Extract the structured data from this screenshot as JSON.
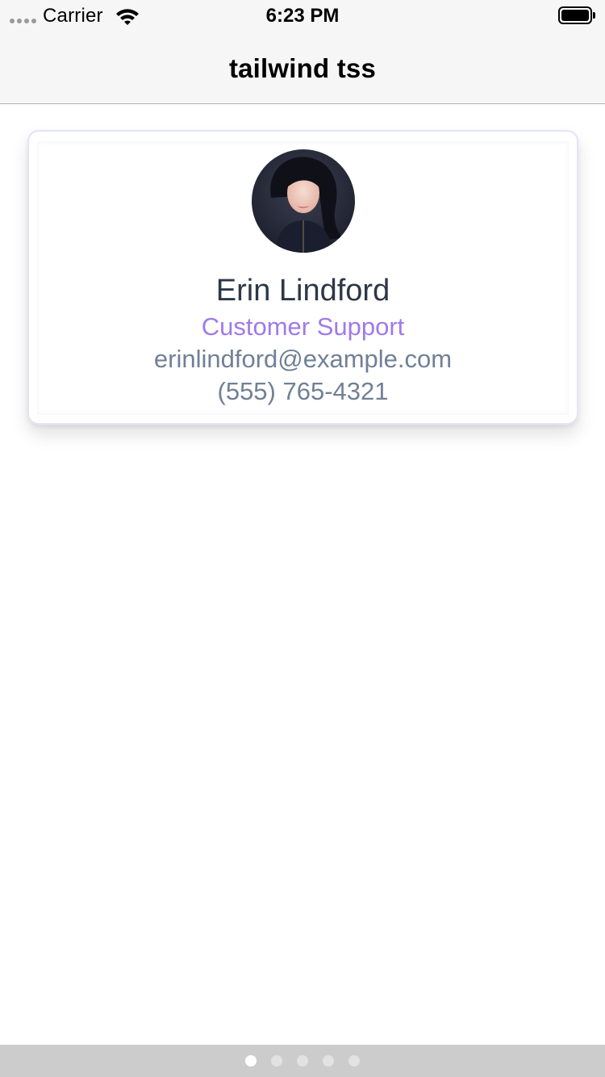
{
  "status_bar": {
    "carrier": "Carrier",
    "time": "6:23 PM"
  },
  "nav": {
    "title": "tailwind tss"
  },
  "profile": {
    "name": "Erin Lindford",
    "role": "Customer Support",
    "email": "erinlindford@example.com",
    "phone": "(555) 765-4321"
  },
  "page_indicator": {
    "count": 5,
    "active_index": 0
  },
  "colors": {
    "name": "#2d3748",
    "role": "#9f7aea",
    "secondary_text": "#718096",
    "card_border": "#e4e4f8",
    "bar_background": "#f6f6f6",
    "page_control_background": "#cccccc"
  },
  "icons": {
    "signal": "signal-dots-icon",
    "wifi": "wifi-icon",
    "battery": "battery-icon"
  }
}
